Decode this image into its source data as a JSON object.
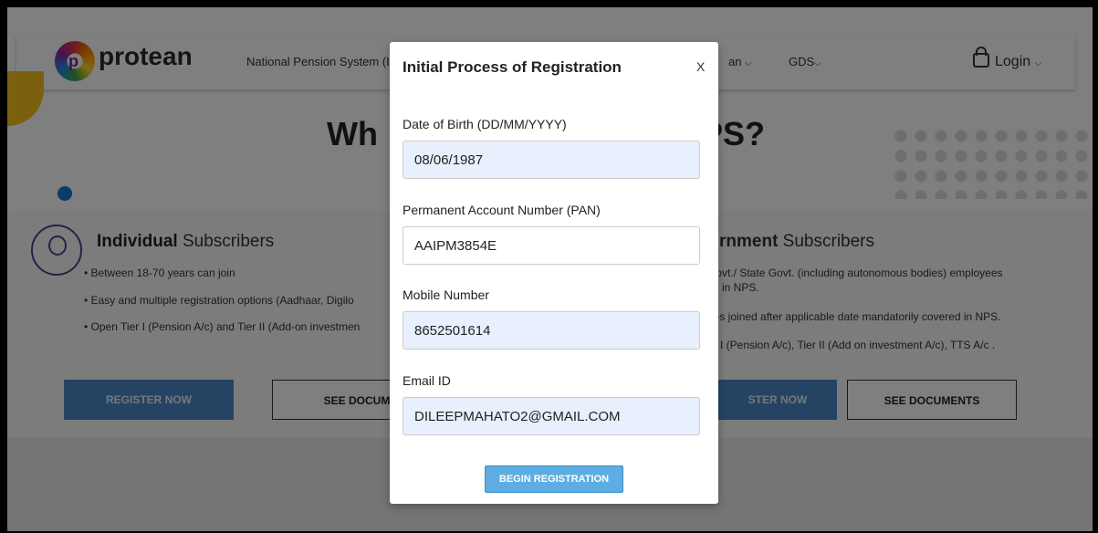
{
  "header": {
    "brand": "protean",
    "nav": [
      "National Pension System (I",
      "an",
      "GDS"
    ],
    "login": "Login"
  },
  "hero": {
    "title_left": "Wh",
    "title_right": "PS?"
  },
  "individual": {
    "title_bold": "Individual",
    "title_rest": " Subscribers",
    "bullets": [
      "Between 18-70 years can join",
      "Easy and multiple registration options (Aadhaar, Digilo",
      "Open Tier I (Pension A/c) and Tier II (Add-on investmen"
    ],
    "register": "REGISTER NOW",
    "documents": "SEE DOCUM"
  },
  "government": {
    "title_bold": "rnment",
    "title_rest": " Subscribers",
    "bullets": [
      "Govt./ State Govt. (including autonomous bodies) employees",
      "in NPS.",
      "ees joined after applicable date mandatorily covered in NPS.",
      "er I (Pension A/c), Tier II (Add on investment A/c), TTS A/c ."
    ],
    "register": "STER NOW",
    "documents": "SEE DOCUMENTS"
  },
  "modal": {
    "title": "Initial Process of Registration",
    "close": "X",
    "fields": [
      {
        "label": "Date of Birth (DD/MM/YYYY)",
        "value": "08/06/1987"
      },
      {
        "label": "Permanent Account Number (PAN)",
        "value": "AAIPM3854E"
      },
      {
        "label": "Mobile Number",
        "value": "8652501614"
      },
      {
        "label": "Email ID",
        "value": "DILEEPMAHATO2@GMAIL.COM"
      }
    ],
    "submit": "BEGIN REGISTRATION"
  }
}
